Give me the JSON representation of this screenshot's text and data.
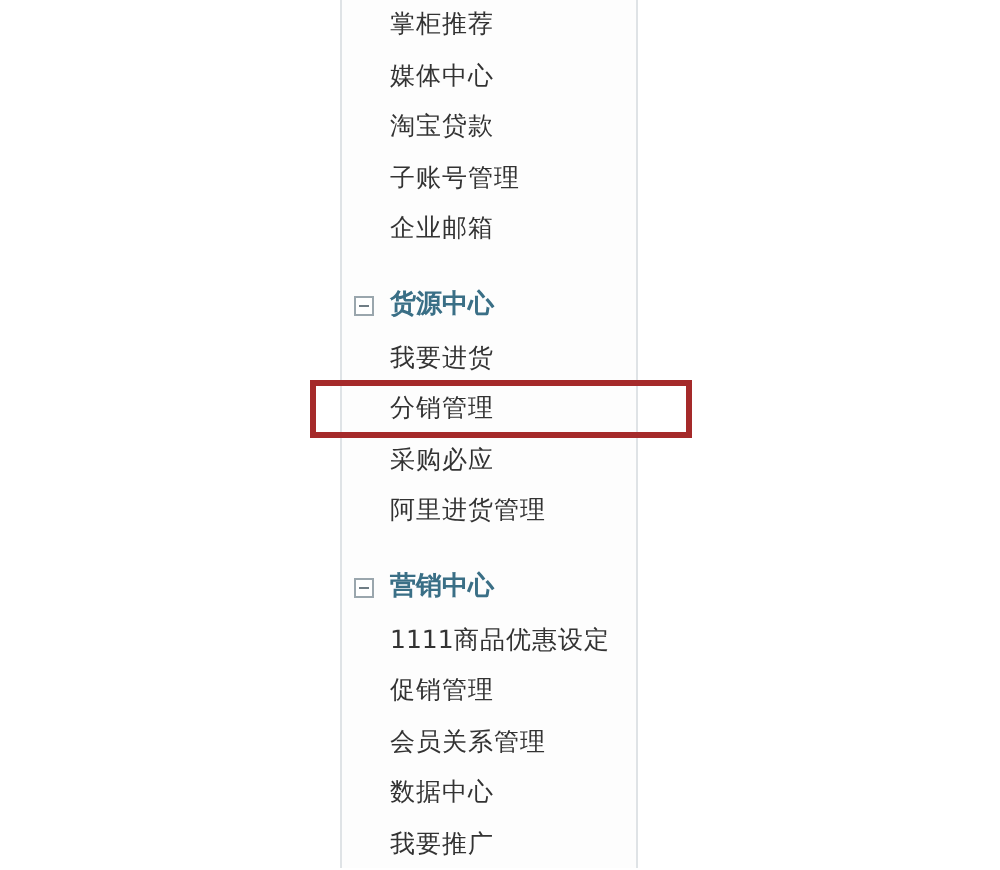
{
  "menu_groups": [
    {
      "items": [
        {
          "label": "掌柜推荐",
          "highlighted": false
        },
        {
          "label": "媒体中心",
          "highlighted": false
        },
        {
          "label": "淘宝贷款",
          "highlighted": false
        },
        {
          "label": "子账号管理",
          "highlighted": false
        },
        {
          "label": "企业邮箱",
          "highlighted": false
        }
      ]
    },
    {
      "title": "货源中心",
      "expanded": true,
      "items": [
        {
          "label": "我要进货",
          "highlighted": false
        },
        {
          "label": "分销管理",
          "highlighted": true
        },
        {
          "label": "采购必应",
          "highlighted": false
        },
        {
          "label": "阿里进货管理",
          "highlighted": false
        }
      ]
    },
    {
      "title": "营销中心",
      "expanded": true,
      "items": [
        {
          "label": "1111商品优惠设定",
          "highlighted": false
        },
        {
          "label": "促销管理",
          "highlighted": false
        },
        {
          "label": "会员关系管理",
          "highlighted": false
        },
        {
          "label": "数据中心",
          "highlighted": false
        },
        {
          "label": "我要推广",
          "highlighted": false
        }
      ]
    }
  ]
}
